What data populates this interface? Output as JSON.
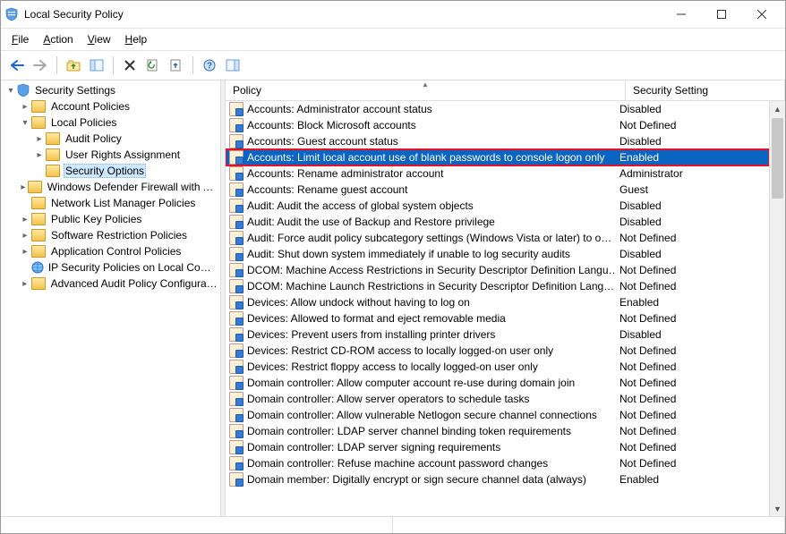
{
  "window": {
    "title": "Local Security Policy"
  },
  "menu": {
    "file": "File",
    "action": "Action",
    "view": "View",
    "help": "Help"
  },
  "toolbar_icons": [
    "back",
    "forward",
    "up",
    "show-hide-tree",
    "delete",
    "refresh",
    "export",
    "help",
    "show-hide-action"
  ],
  "columns": {
    "policy": "Policy",
    "setting": "Security Setting"
  },
  "tree": [
    {
      "icon": "shield",
      "label": "Security Settings",
      "depth": 0,
      "exp": "▾"
    },
    {
      "icon": "folder",
      "label": "Account Policies",
      "depth": 1,
      "exp": "▸"
    },
    {
      "icon": "folder",
      "label": "Local Policies",
      "depth": 1,
      "exp": "▾"
    },
    {
      "icon": "folder",
      "label": "Audit Policy",
      "depth": 2,
      "exp": "▸"
    },
    {
      "icon": "folder",
      "label": "User Rights Assignment",
      "depth": 2,
      "exp": "▸"
    },
    {
      "icon": "folder",
      "label": "Security Options",
      "depth": 2,
      "exp": " ",
      "sel": true
    },
    {
      "icon": "folder",
      "label": "Windows Defender Firewall with Advanced Security",
      "depth": 1,
      "exp": "▸"
    },
    {
      "icon": "folder",
      "label": "Network List Manager Policies",
      "depth": 1,
      "exp": " "
    },
    {
      "icon": "folder",
      "label": "Public Key Policies",
      "depth": 1,
      "exp": "▸"
    },
    {
      "icon": "folder",
      "label": "Software Restriction Policies",
      "depth": 1,
      "exp": "▸"
    },
    {
      "icon": "folder",
      "label": "Application Control Policies",
      "depth": 1,
      "exp": "▸"
    },
    {
      "icon": "ipsec",
      "label": "IP Security Policies on Local Computer",
      "depth": 1,
      "exp": " "
    },
    {
      "icon": "folder",
      "label": "Advanced Audit Policy Configuration",
      "depth": 1,
      "exp": "▸"
    }
  ],
  "policies": [
    {
      "name": "Accounts: Administrator account status",
      "value": "Disabled"
    },
    {
      "name": "Accounts: Block Microsoft accounts",
      "value": "Not Defined"
    },
    {
      "name": "Accounts: Guest account status",
      "value": "Disabled"
    },
    {
      "name": "Accounts: Limit local account use of blank passwords to console logon only",
      "value": "Enabled",
      "sel": true
    },
    {
      "name": "Accounts: Rename administrator account",
      "value": "Administrator"
    },
    {
      "name": "Accounts: Rename guest account",
      "value": "Guest"
    },
    {
      "name": "Audit: Audit the access of global system objects",
      "value": "Disabled"
    },
    {
      "name": "Audit: Audit the use of Backup and Restore privilege",
      "value": "Disabled"
    },
    {
      "name": "Audit: Force audit policy subcategory settings (Windows Vista or later) to o…",
      "value": "Not Defined"
    },
    {
      "name": "Audit: Shut down system immediately if unable to log security audits",
      "value": "Disabled"
    },
    {
      "name": "DCOM: Machine Access Restrictions in Security Descriptor Definition Langu…",
      "value": "Not Defined"
    },
    {
      "name": "DCOM: Machine Launch Restrictions in Security Descriptor Definition Lang…",
      "value": "Not Defined"
    },
    {
      "name": "Devices: Allow undock without having to log on",
      "value": "Enabled"
    },
    {
      "name": "Devices: Allowed to format and eject removable media",
      "value": "Not Defined"
    },
    {
      "name": "Devices: Prevent users from installing printer drivers",
      "value": "Disabled"
    },
    {
      "name": "Devices: Restrict CD-ROM access to locally logged-on user only",
      "value": "Not Defined"
    },
    {
      "name": "Devices: Restrict floppy access to locally logged-on user only",
      "value": "Not Defined"
    },
    {
      "name": "Domain controller: Allow computer account re-use during domain join",
      "value": "Not Defined"
    },
    {
      "name": "Domain controller: Allow server operators to schedule tasks",
      "value": "Not Defined"
    },
    {
      "name": "Domain controller: Allow vulnerable Netlogon secure channel connections",
      "value": "Not Defined"
    },
    {
      "name": "Domain controller: LDAP server channel binding token requirements",
      "value": "Not Defined"
    },
    {
      "name": "Domain controller: LDAP server signing requirements",
      "value": "Not Defined"
    },
    {
      "name": "Domain controller: Refuse machine account password changes",
      "value": "Not Defined"
    },
    {
      "name": "Domain member: Digitally encrypt or sign secure channel data (always)",
      "value": "Enabled"
    }
  ]
}
